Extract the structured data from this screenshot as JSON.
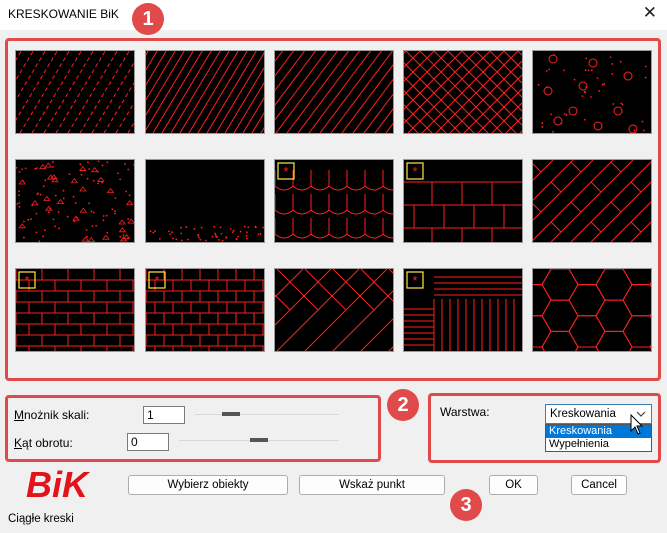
{
  "window": {
    "title": "KRESKOWANIE BiK",
    "close_glyph": "✕"
  },
  "annotations": [
    "1",
    "2",
    "3"
  ],
  "patterns": [
    "ansi31-thin",
    "ansi31-dense",
    "ansi31-wide",
    "ansi37-crosshatch",
    "circles",
    "dots-triangles",
    "dots-sparse",
    "roof-tiles",
    "wood-planks",
    "parquet-diagonal",
    "brick",
    "brick-fine",
    "herringbone",
    "parquet-squares",
    "hexagons"
  ],
  "labels": {
    "scale_prefix": "M",
    "scale_rest": "nożnik skali:",
    "rotation_prefix": "K",
    "rotation_rest": "ąt obrotu:",
    "layer": "Warstwa:"
  },
  "fields": {
    "scale": "1",
    "rotation": "0"
  },
  "layer_select": {
    "value": "Kreskowania",
    "options": [
      "Kreskowania",
      "Wypełnienia"
    ]
  },
  "buttons": {
    "select_objects": "Wybierz obiekty",
    "pick_point": "Wskaż punkt",
    "ok": "OK",
    "cancel": "Cancel"
  },
  "logo_text": "BiK",
  "status_text": "Ciągłe kreski",
  "colors": {
    "accent_red": "#e04a4a",
    "pattern_red": "#ff2020",
    "logo_red": "#e3131b",
    "selection_blue": "#0078d7"
  }
}
